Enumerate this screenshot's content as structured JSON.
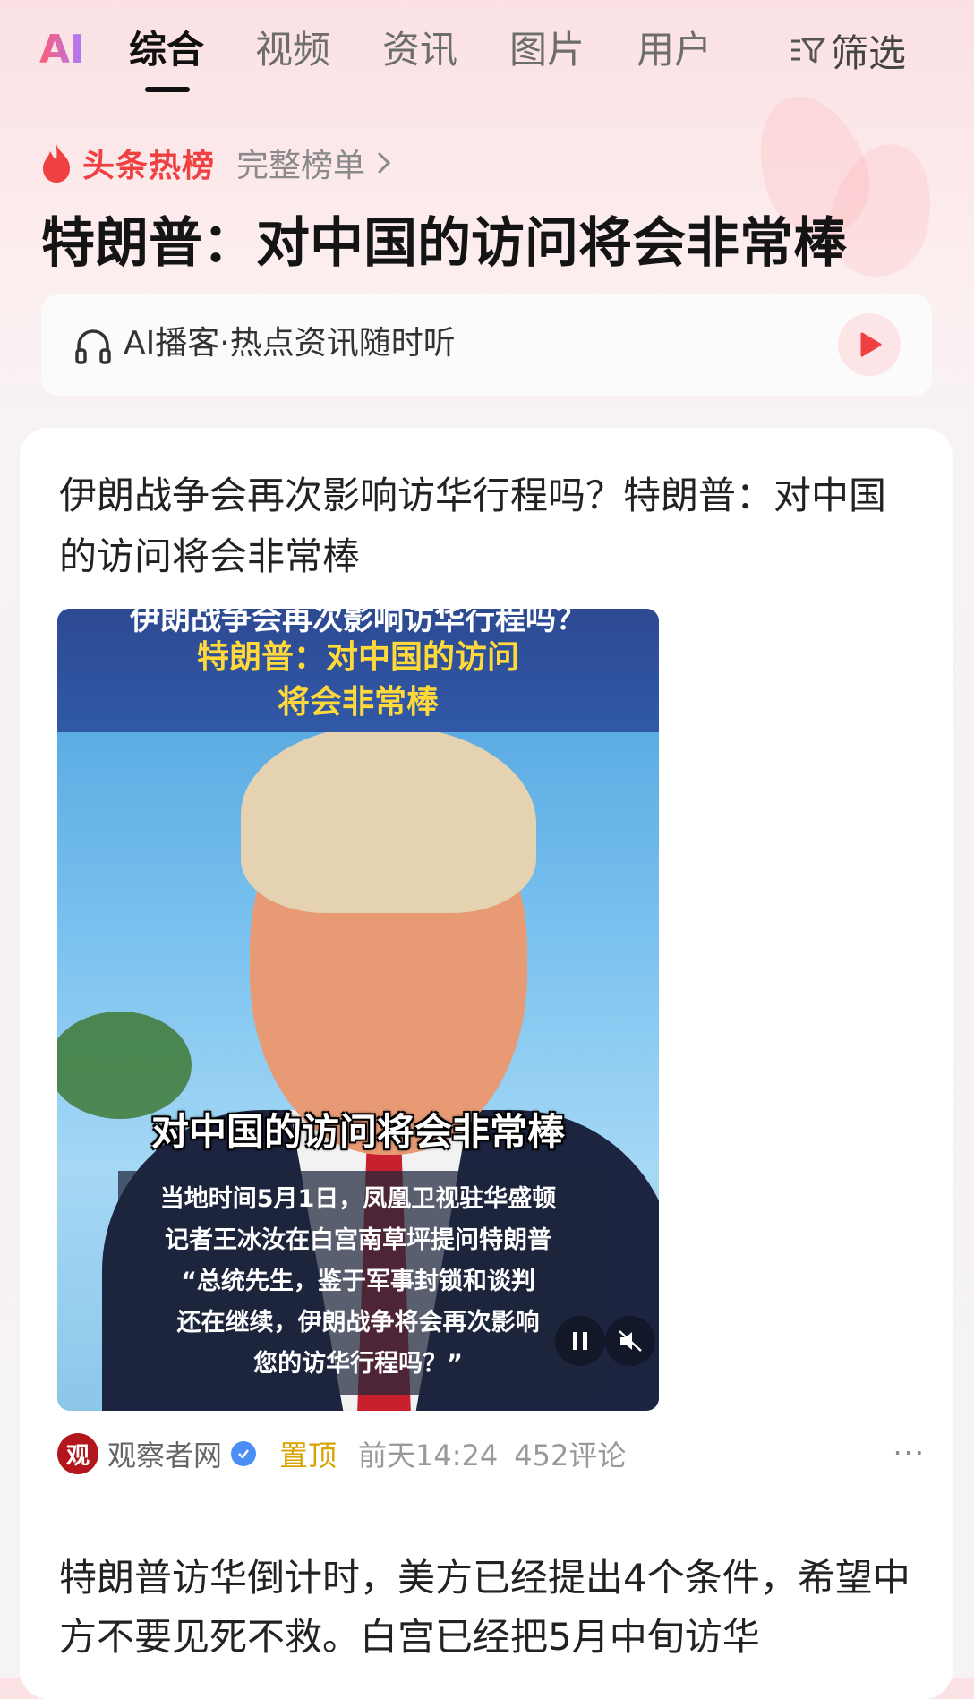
{
  "nav": {
    "ai_label": "AI",
    "tabs": [
      {
        "label": "综合",
        "active": true
      },
      {
        "label": "视频",
        "active": false
      },
      {
        "label": "资讯",
        "active": false
      },
      {
        "label": "图片",
        "active": false
      },
      {
        "label": "用户",
        "active": false
      }
    ],
    "filter_label": "筛选",
    "filter_icon": "filter-icon"
  },
  "hotlist": {
    "icon": "flame-icon",
    "label": "头条热榜",
    "full_list_label": "完整榜单",
    "headline": "特朗普：对中国的访问将会非常棒"
  },
  "podcast": {
    "icon": "headphones-icon",
    "label": "AI播客·热点资讯随时听",
    "play_icon": "play-icon"
  },
  "article": {
    "title": "伊朗战争会再次影响访华行程吗？特朗普：对中国的访问将会非常棒",
    "video": {
      "banner_line1": "伊朗战争会再次影响访华行程吗？",
      "banner_line2": "特朗普：对中国的访问",
      "banner_line3": "将会非常棒",
      "caption_big": "对中国的访问将会非常棒",
      "caption_lines": [
        "当地时间5月1日，凤凰卫视驻华盛顿",
        "记者王冰汝在白宫南草坪提问特朗普",
        "“总统先生，鉴于军事封锁和谈判",
        "还在继续，伊朗战争将会再次影响",
        "您的访华行程吗？”"
      ]
    },
    "source_logo_text": "观",
    "source": "观察者网",
    "pinned": "置顶",
    "time": "前天14:24",
    "comments": "452评论",
    "more": "···",
    "snippet": "特朗普访华倒计时，美方已经提出4个条件，希望中方不要见死不救。白宫已经把5月中旬访华"
  },
  "colors": {
    "accent_red": "#f04142",
    "pin_gold": "#d8a300",
    "verified_blue": "#4b8ef5"
  }
}
